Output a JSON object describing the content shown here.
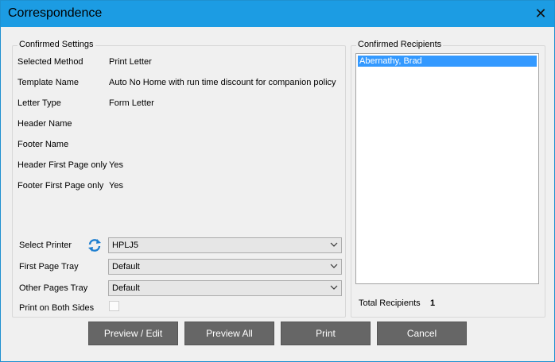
{
  "window": {
    "title": "Correspondence"
  },
  "settings": {
    "group_title": "Confirmed Settings",
    "rows": [
      {
        "label": "Selected Method",
        "value": "Print Letter"
      },
      {
        "label": "Template Name",
        "value": "Auto No Home with run time discount for companion policy"
      },
      {
        "label": "Letter Type",
        "value": "Form Letter"
      },
      {
        "label": "Header Name",
        "value": ""
      },
      {
        "label": "Footer Name",
        "value": ""
      },
      {
        "label": "Header First Page only",
        "value": "Yes"
      },
      {
        "label": "Footer First Page only",
        "value": "Yes"
      }
    ]
  },
  "printer": {
    "select_printer_label": "Select Printer",
    "printer_value": "HPLJ5",
    "first_tray_label": "First Page Tray",
    "first_tray_value": "Default",
    "other_tray_label": "Other Pages Tray",
    "other_tray_value": "Default",
    "both_sides_label": "Print on Both Sides",
    "both_sides_checked": false
  },
  "recipients": {
    "group_title": "Confirmed Recipients",
    "items": [
      "Abernathy, Brad"
    ],
    "total_label": "Total Recipients",
    "total_value": "1"
  },
  "buttons": {
    "preview_edit": "Preview / Edit",
    "preview_all": "Preview All",
    "print": "Print",
    "cancel": "Cancel"
  },
  "icons": {
    "close": "close-icon",
    "refresh": "refresh-icon",
    "chevron": "chevron-down-icon"
  },
  "colors": {
    "titlebar": "#1c9ce3",
    "button": "#666666",
    "selection": "#3399ff",
    "refresh_icon": "#1e7fd0"
  }
}
